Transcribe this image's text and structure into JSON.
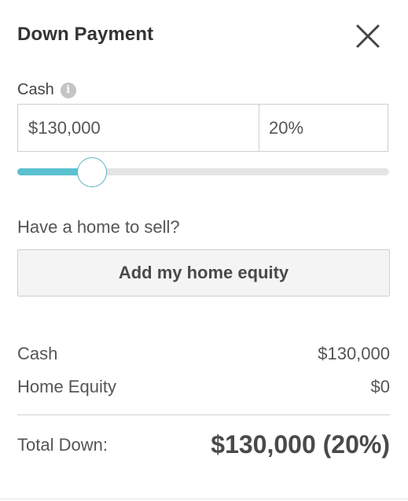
{
  "header": {
    "title": "Down Payment",
    "close_icon": "close-icon"
  },
  "cash_input": {
    "label": "Cash",
    "info_icon": "info-icon",
    "info_glyph": "i",
    "amount_value": "$130,000",
    "percent_value": "20%"
  },
  "slider": {
    "value_percent": 20,
    "fill_fraction": 0.2,
    "fill_color": "#5bc0cf",
    "track_color": "#e4e4e4"
  },
  "home_sale": {
    "question": "Have a home to sell?",
    "button_label": "Add my home equity"
  },
  "summary": {
    "cash_label": "Cash",
    "cash_value": "$130,000",
    "equity_label": "Home Equity",
    "equity_value": "$0",
    "total_label": "Total Down:",
    "total_value": "$130,000 (20%)"
  }
}
